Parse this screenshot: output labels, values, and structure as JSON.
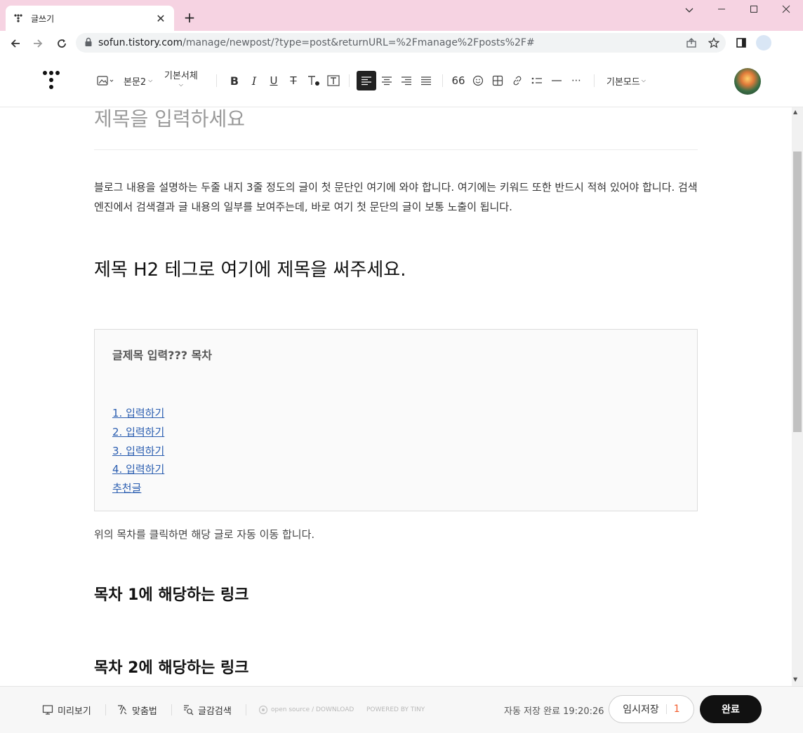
{
  "browser": {
    "tab_title": "글쓰기",
    "url_domain": "sofun.tistory.com",
    "url_path": "/manage/newpost/?type=post&returnURL=%2Fmanage%2Fposts%2F#"
  },
  "editor_toolbar": {
    "paragraph_style": "본문2",
    "font_family": "기본서체",
    "mode": "기본모드",
    "quote_label": "66"
  },
  "document": {
    "title_placeholder": "제목을 입력하세요",
    "intro_paragraph": "블로그 내용을 설명하는 두줄 내지 3줄 정도의 글이 첫 문단인 여기에 와야 합니다.  여기에는 키워드 또한 반드시 적혀 있어야 합니다. 검색엔진에서 검색결과 글 내용의 일부를 보여주는데, 바로 여기 첫 문단의 글이 보통 노출이 됩니다.",
    "h2_heading": "제목 H2 테그로 여기에 제목을 써주세요.",
    "toc": {
      "title": "글제목 입력??? 목차",
      "items": [
        "1. 입력하기",
        "2. 입력하기",
        "3. 입력하기",
        "4. 입력하기",
        "추천글"
      ]
    },
    "toc_note": "위의 목차를 클릭하면 해당 글로 자동 이동 합니다.",
    "sections": [
      "목차 1에 해당하는 링크",
      "목차 2에 해당하는 링크"
    ]
  },
  "footer": {
    "preview_label": "미리보기",
    "spellcheck_label": "맞춤법",
    "search_label": "글감검색",
    "opensource_label": "open source / DOWNLOAD",
    "powered_label": "POWERED BY TINY",
    "autosave_text": "자동 저장 완료 19:20:26",
    "draft_label": "임시저장",
    "draft_count": "1",
    "done_label": "완료"
  }
}
